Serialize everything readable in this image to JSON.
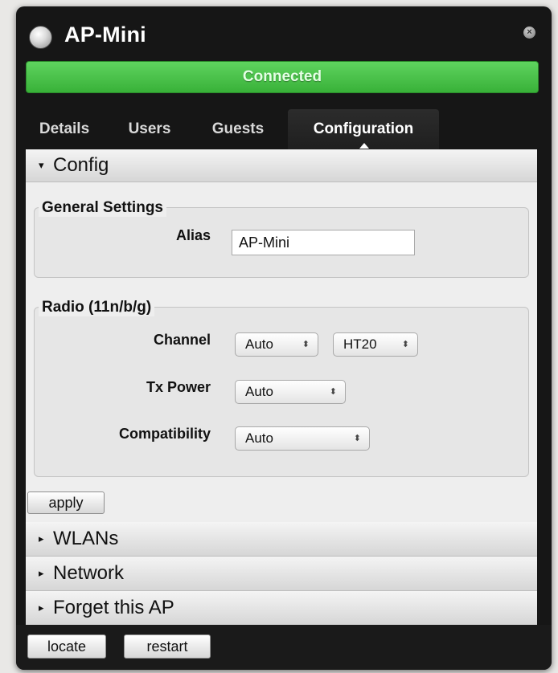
{
  "window": {
    "title": "AP-Mini",
    "close_icon": "close-icon"
  },
  "status": {
    "text": "Connected",
    "color": "#3cb43c"
  },
  "tabs": [
    {
      "label": "Details"
    },
    {
      "label": "Users"
    },
    {
      "label": "Guests"
    },
    {
      "label": "Configuration",
      "active": true
    }
  ],
  "config": {
    "header": "Config",
    "general": {
      "legend": "General Settings",
      "alias_label": "Alias",
      "alias_value": "AP-Mini"
    },
    "radio": {
      "legend": "Radio (11n/b/g)",
      "channel_label": "Channel",
      "channel_value": "Auto",
      "width_value": "HT20",
      "txpower_label": "Tx Power",
      "txpower_value": "Auto",
      "compat_label": "Compatibility",
      "compat_value": "Auto"
    },
    "apply_label": "apply"
  },
  "sections": [
    {
      "label": "WLANs"
    },
    {
      "label": "Network"
    },
    {
      "label": "Forget this AP"
    }
  ],
  "footer": {
    "locate_label": "locate",
    "restart_label": "restart"
  },
  "glyphs": {
    "expanded": "▾",
    "collapsed": "▸",
    "updown": "⬍"
  }
}
